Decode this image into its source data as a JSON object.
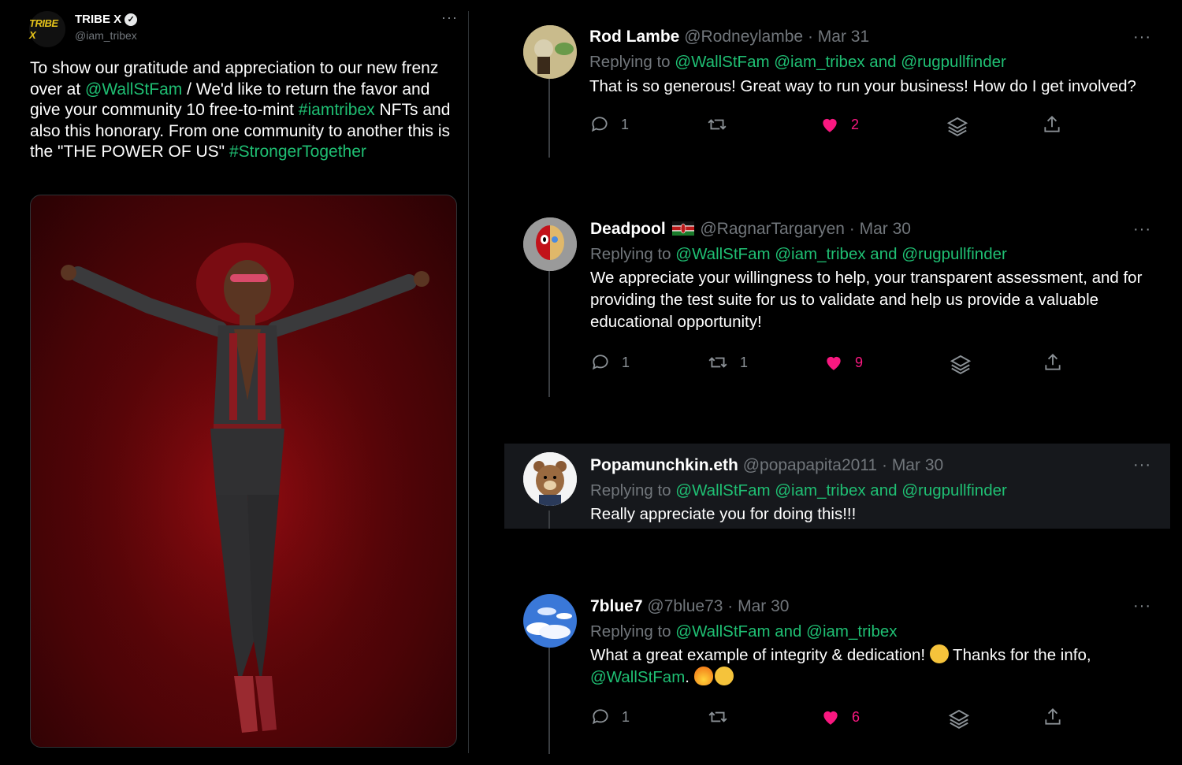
{
  "left_tweet": {
    "logo_text": "TRIBE X",
    "name": "TRIBE X",
    "handle": "@iam_tribex",
    "more": "···",
    "body": [
      {
        "t": "To show our gratitude and appreciation to our new frenz over at ",
        "link": false
      },
      {
        "t": "@WallStFam",
        "link": true
      },
      {
        "t": " / We'd like to return the favor and give your community 10 free-to-mint ",
        "link": false
      },
      {
        "t": "#iamtribex",
        "link": true
      },
      {
        "t": " NFTs and also this honorary. From one community to another this is the \"THE POWER OF US\" ",
        "link": false
      },
      {
        "t": "#StrongerTogether",
        "link": true
      }
    ]
  },
  "replies": [
    {
      "name": "Rod Lambe",
      "handle": "@Rodneylambe",
      "sep": "·",
      "date": "Mar 31",
      "replying_prefix": "Replying to ",
      "replying_to": "@WallStFam @iam_tribex and @rugpullfinder",
      "text": "That is so generous! Great way to run your business! How do I get involved?",
      "replies": "1",
      "retweets": "",
      "likes": "2"
    },
    {
      "name": "Deadpool",
      "handle": "@RagnarTargaryen",
      "sep": "·",
      "date": "Mar 30",
      "replying_prefix": "Replying to ",
      "replying_to": "@WallStFam @iam_tribex and @rugpullfinder",
      "text": "We appreciate your willingness to help, your transparent assessment, and for providing the test suite for us to validate and help us provide a valuable educational opportunity!",
      "replies": "1",
      "retweets": "1",
      "likes": "9"
    },
    {
      "name": "Popamunchkin.eth",
      "handle": "@popapapita2011",
      "sep": "·",
      "date": "Mar 30",
      "replying_prefix": "Replying to ",
      "replying_to": "@WallStFam @iam_tribex and @rugpullfinder",
      "text": "Really appreciate you for doing this!!!"
    },
    {
      "name": "7blue7",
      "handle": "@7blue73",
      "sep": "·",
      "date": "Mar 30",
      "replying_prefix": "Replying to ",
      "replying_to": "@WallStFam and @iam_tribex",
      "text_a": "What a great example of integrity & dedication! ",
      "text_b": " Thanks for the info,",
      "mention": "@WallStFam",
      "text_c": ". ",
      "replies": "1",
      "retweets": "",
      "likes": "6"
    }
  ],
  "more_label": "···",
  "colors": {
    "accent": "#1fbf73",
    "like": "#f91880",
    "muted": "#71767b"
  }
}
